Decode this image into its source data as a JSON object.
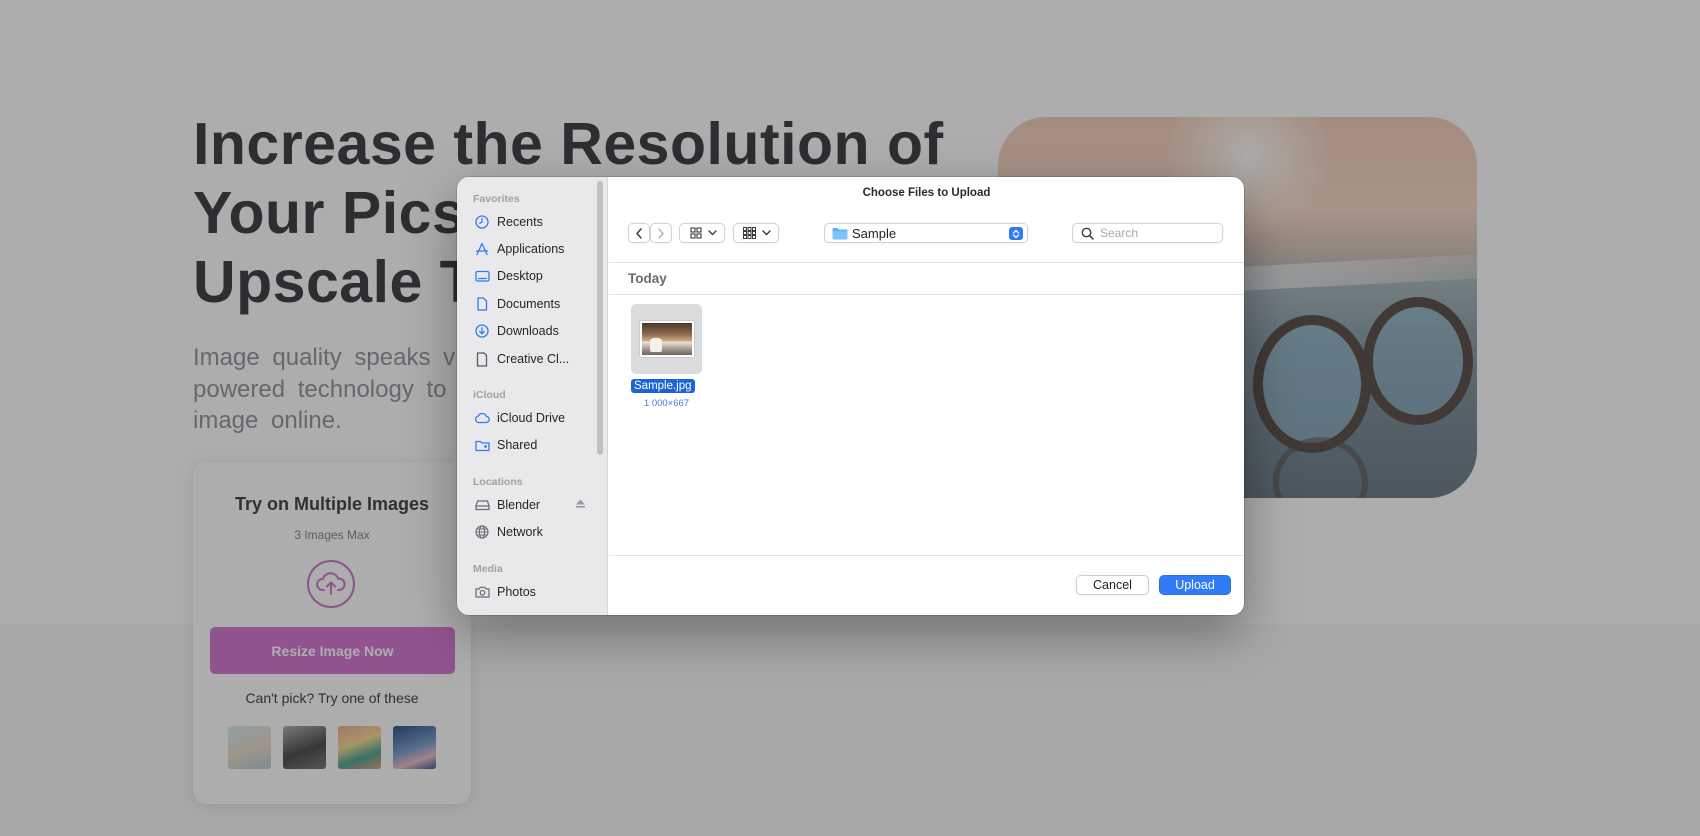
{
  "page": {
    "hero_title_lines": [
      "Increase the Resolution of",
      "Your Pics w",
      "Upscale To"
    ],
    "hero_subtitle_lines": [
      "Image quality speaks v",
      "powered technology to",
      "image online."
    ],
    "upload_card": {
      "title": "Try on Multiple Images",
      "subtitle": "3 Images Max",
      "button_label": "Resize Image Now",
      "cant_pick": "Can't pick? Try one of these"
    },
    "accent_color": "#d36bd0"
  },
  "dialog": {
    "title": "Choose Files to Upload",
    "sidebar": {
      "favorites_label": "Favorites",
      "favorites": [
        {
          "label": "Recents",
          "icon": "clock-icon"
        },
        {
          "label": "Applications",
          "icon": "applications-icon"
        },
        {
          "label": "Desktop",
          "icon": "desktop-icon"
        },
        {
          "label": "Documents",
          "icon": "document-icon"
        },
        {
          "label": "Downloads",
          "icon": "download-icon"
        },
        {
          "label": "Creative Cl...",
          "icon": "file-icon"
        }
      ],
      "icloud_label": "iCloud",
      "icloud": [
        {
          "label": "iCloud Drive",
          "icon": "cloud-icon"
        },
        {
          "label": "Shared",
          "icon": "shared-folder-icon"
        }
      ],
      "locations_label": "Locations",
      "locations": [
        {
          "label": "Blender",
          "icon": "drive-icon"
        },
        {
          "label": "Network",
          "icon": "globe-icon"
        }
      ],
      "media_label": "Media",
      "media": [
        {
          "label": "Photos",
          "icon": "camera-icon"
        }
      ]
    },
    "toolbar": {
      "location": "Sample",
      "search_placeholder": "Search"
    },
    "group_label": "Today",
    "files": [
      {
        "name": "Sample.jpg",
        "dims": "1 000×667",
        "selected": true
      }
    ],
    "buttons": {
      "cancel": "Cancel",
      "upload": "Upload"
    },
    "accent_color": "#2f7cf6"
  }
}
